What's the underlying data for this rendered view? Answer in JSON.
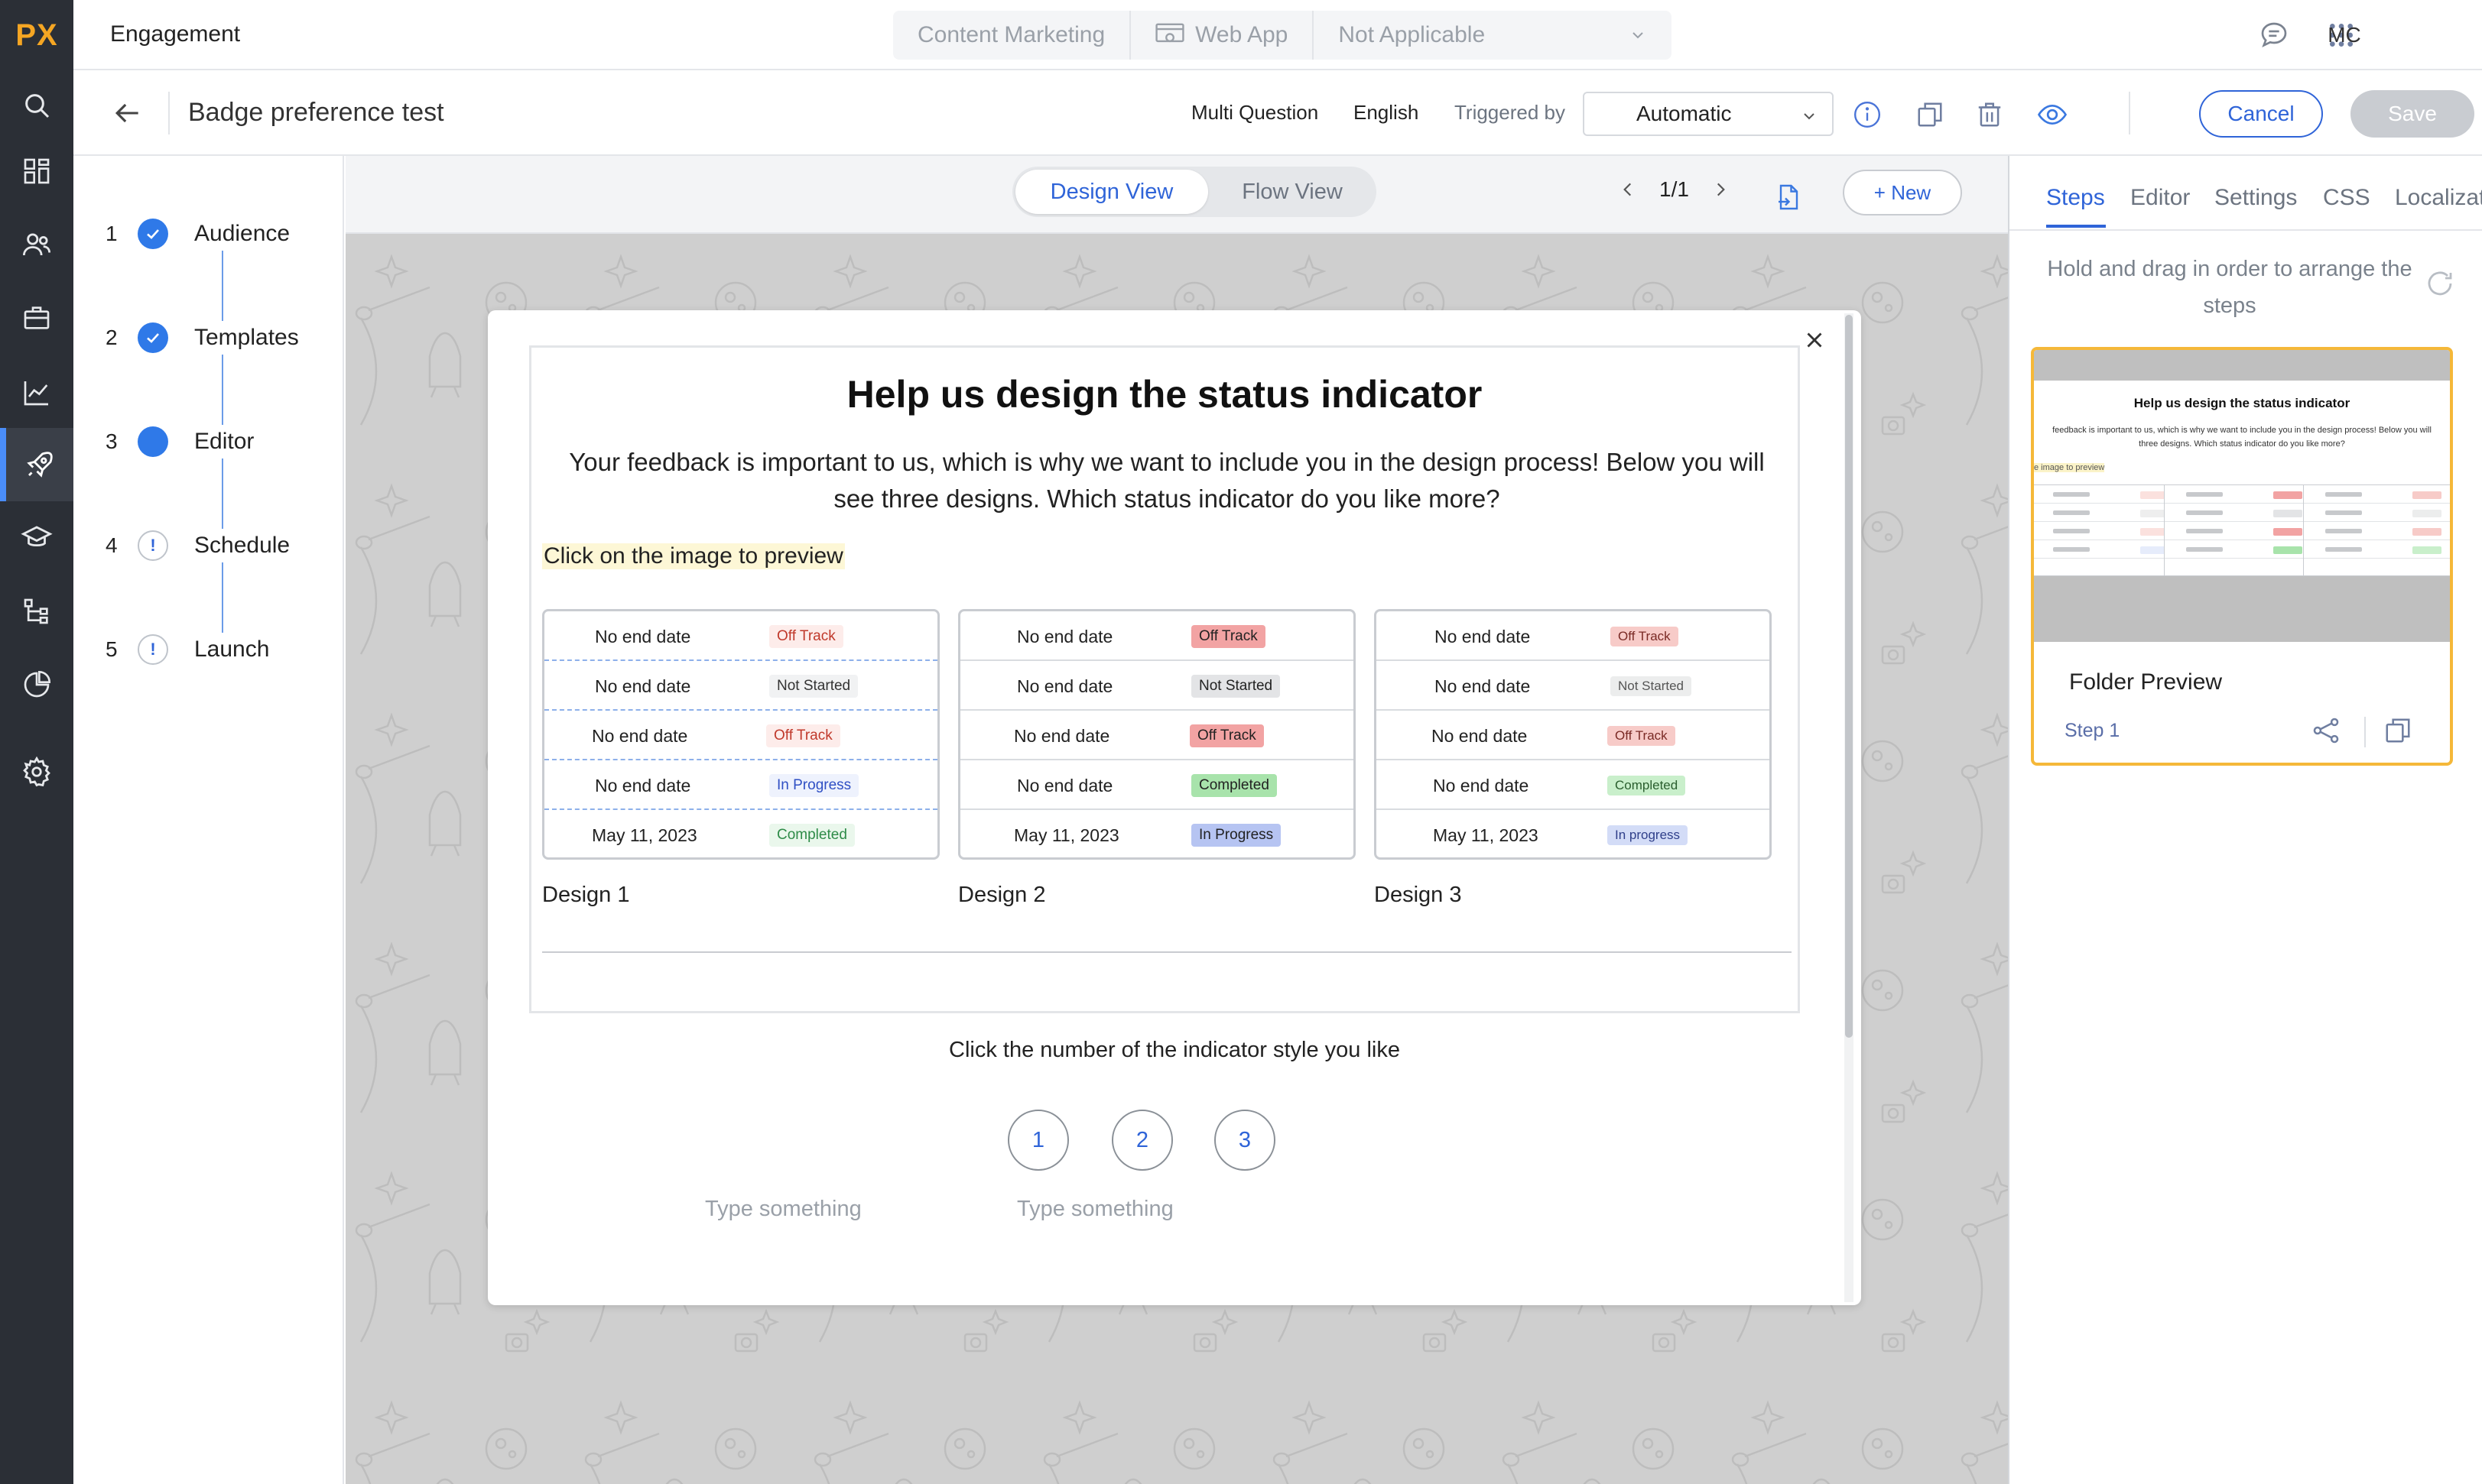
{
  "colors": {
    "brand": "#F5A623",
    "accent": "#2F64D8",
    "rail": "#2B2F36",
    "selected_card_border": "#F5B839"
  },
  "brand": {
    "logo": "PX"
  },
  "rail": {
    "icons": [
      "search-icon",
      "dashboard-icon",
      "users-icon",
      "briefcase-icon",
      "analytics-icon",
      "rocket-icon",
      "graduation-cap-icon",
      "workflow-icon",
      "pie-chart-icon",
      "settings-icon"
    ],
    "active": "rocket-icon"
  },
  "header": {
    "app_title": "Engagement",
    "context": {
      "product": "Content Marketing",
      "app": "Web App",
      "environment": "Not Applicable"
    },
    "icons": [
      "chat-icon",
      "apps-grid-icon"
    ],
    "avatar": "MC"
  },
  "subheader": {
    "title": "Badge preference test",
    "type": "Multi Question",
    "language": "English",
    "triggered_by_label": "Triggered by",
    "trigger_value": "Automatic",
    "cancel": "Cancel",
    "save": "Save"
  },
  "steps": [
    {
      "num": "1",
      "label": "Audience",
      "status": "done"
    },
    {
      "num": "2",
      "label": "Templates",
      "status": "done"
    },
    {
      "num": "3",
      "label": "Editor",
      "status": "current"
    },
    {
      "num": "4",
      "label": "Schedule",
      "status": "warning"
    },
    {
      "num": "5",
      "label": "Launch",
      "status": "warning"
    }
  ],
  "canvas": {
    "views": {
      "design": "Design View",
      "flow": "Flow View",
      "active": "Design View"
    },
    "pager": "1/1",
    "new_button": "+ New"
  },
  "survey": {
    "title": "Help us design the status indicator",
    "description": "Your feedback is important to us, which is why we want to include you in the design process! Below you will see three designs. Which status indicator do you like more?",
    "hint": "Click on the image to preview",
    "designs": [
      {
        "caption": "Design 1",
        "rows": [
          {
            "date": "No end date",
            "status": "Off Track"
          },
          {
            "date": "No end date",
            "status": "Not Started"
          },
          {
            "date": "No end date",
            "status": "Off Track"
          },
          {
            "date": "No end date",
            "status": "In Progress"
          },
          {
            "date": "May 11, 2023",
            "status": "Completed"
          }
        ]
      },
      {
        "caption": "Design 2",
        "rows": [
          {
            "date": "No end date",
            "status": "Off Track"
          },
          {
            "date": "No end date",
            "status": "Not Started"
          },
          {
            "date": "No end date",
            "status": "Off Track"
          },
          {
            "date": "No end date",
            "status": "Completed"
          },
          {
            "date": "May 11, 2023",
            "status": "In Progress"
          }
        ]
      },
      {
        "caption": "Design 3",
        "rows": [
          {
            "date": "No end date",
            "status": "Off Track"
          },
          {
            "date": "No end date",
            "status": "Not Started"
          },
          {
            "date": "No end date",
            "status": "Off Track"
          },
          {
            "date": "No end date",
            "status": "Completed"
          },
          {
            "date": "May 11, 2023",
            "status": "In progress"
          }
        ]
      }
    ],
    "question": "Click the number of the indicator style you like",
    "ratings": [
      "1",
      "2",
      "3"
    ],
    "placeholders": [
      "Type something",
      "Type something"
    ]
  },
  "right_panel": {
    "tabs": [
      "Steps",
      "Editor",
      "Settings",
      "CSS",
      "Localizat"
    ],
    "active_tab": "Steps",
    "hint": "Hold and drag in order to arrange the steps",
    "step_card": {
      "name": "Folder Preview",
      "step": "Step 1",
      "thumb_title": "Help us design the status indicator",
      "thumb_desc_1": "feedback is important to us, which is why we want to include you in the design process! Below you will",
      "thumb_desc_2": "three designs. Which status indicator do you like more?",
      "thumb_hint": "e image to preview"
    }
  }
}
